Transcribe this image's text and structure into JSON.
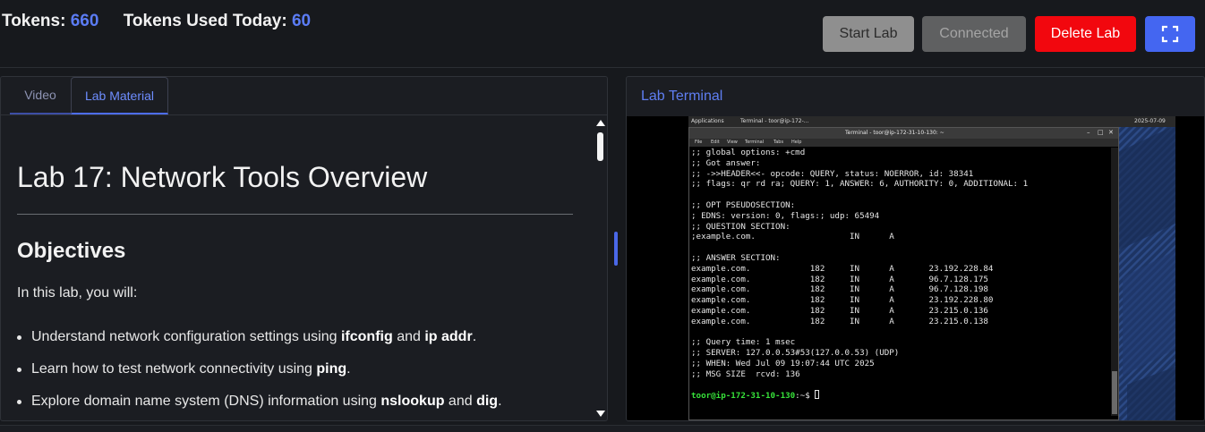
{
  "header": {
    "tokens_label": "Tokens:",
    "tokens_value": "660",
    "used_label": "Tokens Used Today:",
    "used_value": "60",
    "buttons": {
      "start": "Start Lab",
      "connected": "Connected",
      "delete": "Delete Lab",
      "fullscreen_icon": "fullscreen-icon"
    }
  },
  "left_panel": {
    "tabs": [
      {
        "label": "Video"
      },
      {
        "label": "Lab Material",
        "active": true
      }
    ],
    "title": "Lab 17: Network Tools Overview",
    "section_heading": "Objectives",
    "intro": "In this lab, you will:",
    "bullets": [
      {
        "pre": "Understand network configuration settings using ",
        "b1": "ifconfig",
        "mid": " and ",
        "b2": "ip addr",
        "post": "."
      },
      {
        "pre": "Learn how to test network connectivity using ",
        "b1": "ping",
        "post": "."
      },
      {
        "pre": "Explore domain name system (DNS) information using ",
        "b1": "nslookup",
        "mid": " and ",
        "b2": "dig",
        "post": "."
      }
    ]
  },
  "right_panel": {
    "title": "Lab Terminal",
    "desktop_panel": {
      "applications": "Applications",
      "task": "Terminal - toor@ip-172-...",
      "clock": "2025-07-09"
    },
    "terminal": {
      "window_title": "Terminal - toor@ip-172-31-10-130: ~",
      "menu": [
        "File",
        "Edit",
        "View",
        "Terminal",
        "Tabs",
        "Help"
      ],
      "lines": [
        ";; global options: +cmd",
        ";; Got answer:",
        ";; ->>HEADER<<- opcode: QUERY, status: NOERROR, id: 38341",
        ";; flags: qr rd ra; QUERY: 1, ANSWER: 6, AUTHORITY: 0, ADDITIONAL: 1",
        "",
        ";; OPT PSEUDOSECTION:",
        "; EDNS: version: 0, flags:; udp: 65494",
        ";; QUESTION SECTION:",
        ";example.com.                   IN      A",
        "",
        ";; ANSWER SECTION:",
        "example.com.            182     IN      A       23.192.228.84",
        "example.com.            182     IN      A       96.7.128.175",
        "example.com.            182     IN      A       96.7.128.198",
        "example.com.            182     IN      A       23.192.228.80",
        "example.com.            182     IN      A       23.215.0.136",
        "example.com.            182     IN      A       23.215.0.138",
        "",
        ";; Query time: 1 msec",
        ";; SERVER: 127.0.0.53#53(127.0.0.53) (UDP)",
        ";; WHEN: Wed Jul 09 19:07:44 UTC 2025",
        ";; MSG SIZE  rcvd: 136",
        ""
      ],
      "prompt_user": "toor@ip-172-31-10-130",
      "prompt_suffix": ":~$ "
    }
  }
}
